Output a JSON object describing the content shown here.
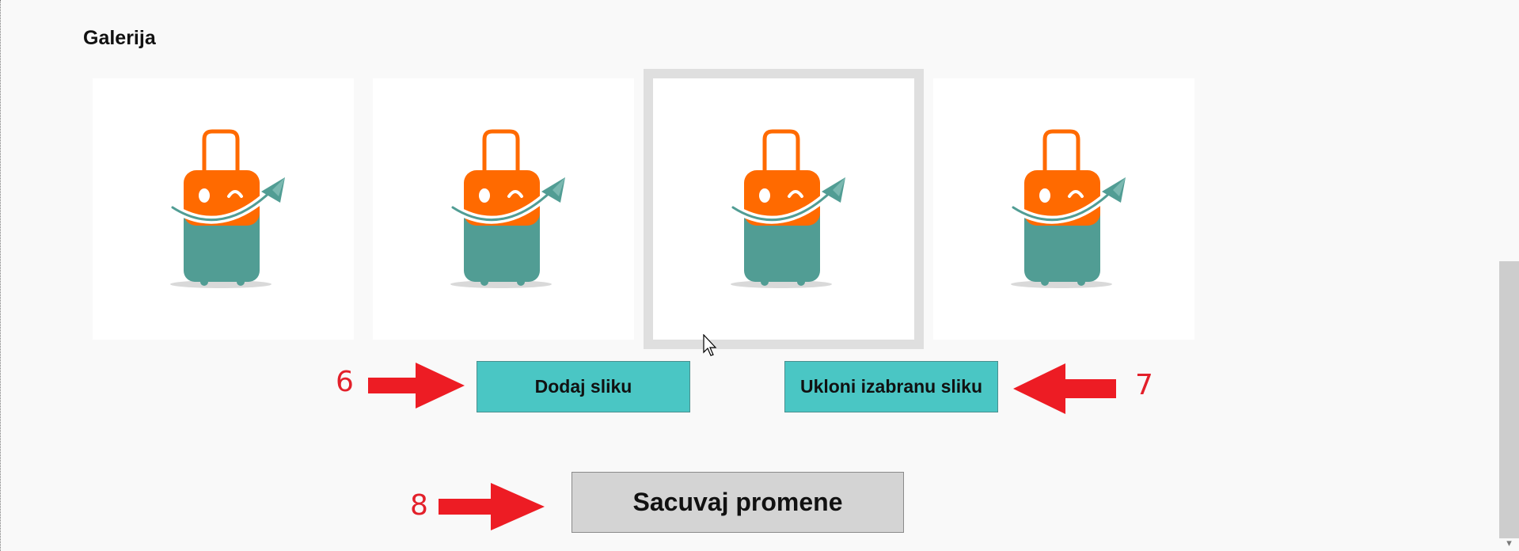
{
  "gallery": {
    "title": "Galerija",
    "images": [
      {
        "icon": "suitcase-mascot-icon",
        "selected": false
      },
      {
        "icon": "suitcase-mascot-icon",
        "selected": false
      },
      {
        "icon": "suitcase-mascot-icon",
        "selected": true
      },
      {
        "icon": "suitcase-mascot-icon",
        "selected": false
      }
    ]
  },
  "buttons": {
    "add_image": "Dodaj sliku",
    "remove_image": "Ukloni izabranu sliku",
    "save_changes": "Sacuvaj promene"
  },
  "annotations": [
    "6",
    "7",
    "8"
  ],
  "colors": {
    "accent_teal": "#4ac6c4",
    "annotation_red": "#ed1c24",
    "mascot_orange": "#ff6a00",
    "mascot_green": "#519d94"
  }
}
